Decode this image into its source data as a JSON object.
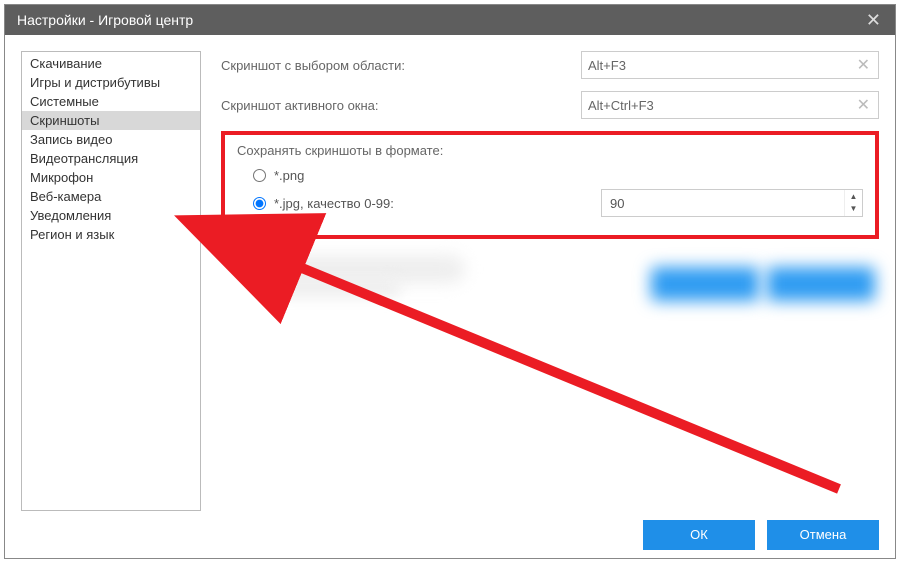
{
  "window": {
    "title": "Настройки - Игровой центр"
  },
  "sidebar": {
    "items": [
      {
        "label": "Скачивание"
      },
      {
        "label": "Игры и дистрибутивы"
      },
      {
        "label": "Системные"
      },
      {
        "label": "Скриншоты",
        "selected": true
      },
      {
        "label": "Запись видео"
      },
      {
        "label": "Видеотрансляция"
      },
      {
        "label": "Микрофон"
      },
      {
        "label": "Веб-камера"
      },
      {
        "label": "Уведомления"
      },
      {
        "label": "Регион и язык"
      }
    ]
  },
  "settings": {
    "hotkey_area_label": "Скриншот с выбором области:",
    "hotkey_area_value": "Alt+F3",
    "hotkey_window_label": "Скриншот активного окна:",
    "hotkey_window_value": "Alt+Ctrl+F3",
    "format_title": "Сохранять скриншоты в формате:",
    "radio_png": "*.png",
    "radio_jpg": "*.jpg, качество 0-99:",
    "jpg_quality": "90",
    "selected_format": "jpg"
  },
  "footer": {
    "ok": "ОК",
    "cancel": "Отмена"
  }
}
